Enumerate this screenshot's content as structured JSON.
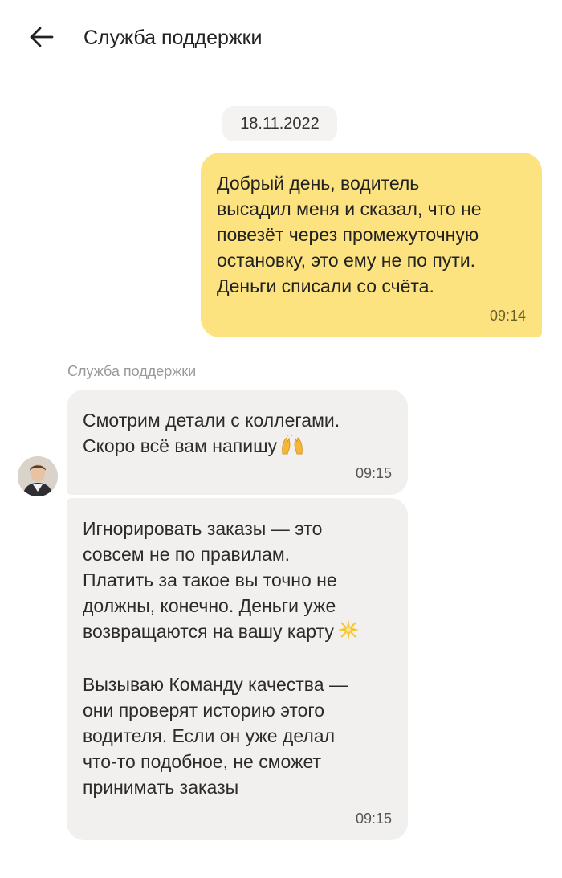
{
  "header": {
    "back_icon": "arrow-left-icon",
    "title": "Служба поддержки"
  },
  "chat": {
    "date": "18.11.2022",
    "messages": [
      {
        "direction": "outgoing",
        "text": "Добрый день, водитель\nвысадил меня и сказал, что не\nповезёт через промежуточную\nостановку, это ему не по пути.\nДеньги списали со счёта.",
        "time": "09:14",
        "bubble_color": "#fce380"
      },
      {
        "direction": "incoming",
        "sender": "Служба поддержки",
        "text": "Смотрим детали с коллегами.\nСкоро всё вам напишу",
        "emoji": "raised-hands-icon",
        "time": "09:15",
        "bubble_color": "#f1f0ee"
      },
      {
        "direction": "incoming",
        "paragraph1": "Игнорировать заказы — это\nсовсем не по правилам.\nПлатить за такое вы точно не\nдолжны, конечно. Деньги уже\nвозвращаются на вашу карту",
        "paragraph1_emoji": "sparkle-icon",
        "paragraph2": "Вызываю Команду качества —\nони проверят историю этого\nводителя. Если он уже делал\nчто-то подобное, не сможет\nпринимать заказы",
        "time": "09:15",
        "bubble_color": "#f1f0ee"
      }
    ]
  }
}
